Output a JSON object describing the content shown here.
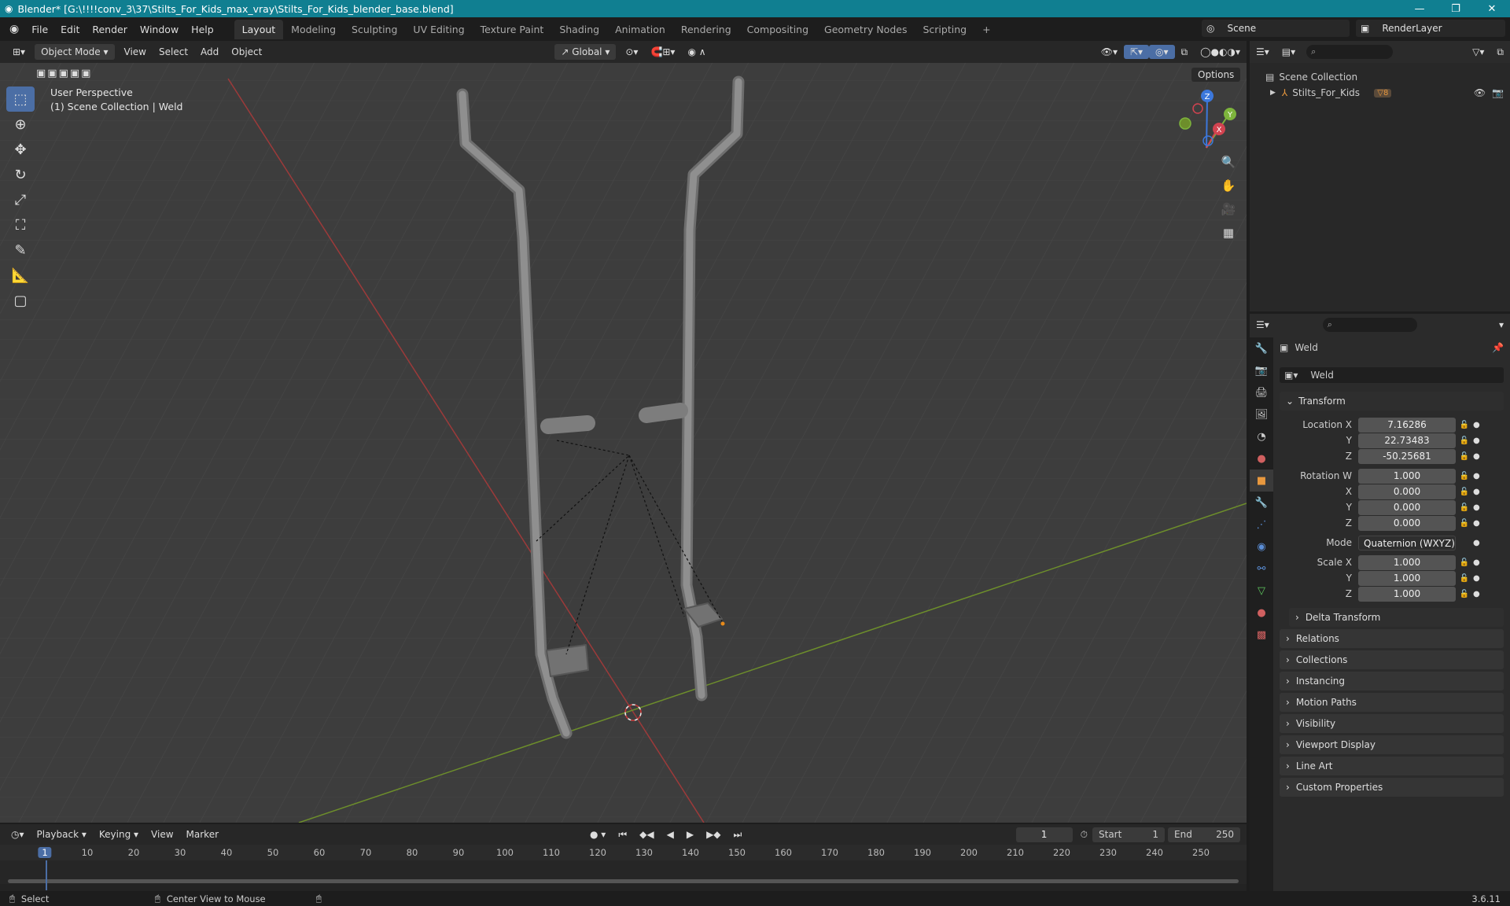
{
  "window": {
    "title": "Blender* [G:\\!!!!conv_3\\37\\Stilts_For_Kids_max_vray\\Stilts_For_Kids_blender_base.blend]"
  },
  "menu": [
    "File",
    "Edit",
    "Render",
    "Window",
    "Help"
  ],
  "workspaces": [
    "Layout",
    "Modeling",
    "Sculpting",
    "UV Editing",
    "Texture Paint",
    "Shading",
    "Animation",
    "Rendering",
    "Compositing",
    "Geometry Nodes",
    "Scripting"
  ],
  "scene": "Scene",
  "render_layer": "RenderLayer",
  "viewport": {
    "mode": "Object Mode",
    "menus": [
      "View",
      "Select",
      "Add",
      "Object"
    ],
    "orientation": "Global",
    "options": "Options",
    "info_line1": "User Perspective",
    "info_line2": "(1) Scene Collection | Weld",
    "gizmo": {
      "x": "X",
      "y": "Y",
      "z": "Z"
    }
  },
  "outliner": {
    "root": "Scene Collection",
    "item": "Stilts_For_Kids",
    "item_badge": "8"
  },
  "properties": {
    "object_name": "Weld",
    "data_name": "Weld",
    "transform_label": "Transform",
    "location_x_label": "Location X",
    "location_x": "7.16286",
    "location_y_label": "Y",
    "location_y": "22.73483",
    "location_z_label": "Z",
    "location_z": "-50.25681",
    "rotation_w_label": "Rotation W",
    "rotation_w": "1.000",
    "rotation_x_label": "X",
    "rotation_x": "0.000",
    "rotation_y_label": "Y",
    "rotation_y": "0.000",
    "rotation_z_label": "Z",
    "rotation_z": "0.000",
    "mode_label": "Mode",
    "mode": "Quaternion (WXYZ)",
    "scale_x_label": "Scale X",
    "scale_x": "1.000",
    "scale_y_label": "Y",
    "scale_y": "1.000",
    "scale_z_label": "Z",
    "scale_z": "1.000",
    "delta_transform": "Delta Transform",
    "panels": [
      "Relations",
      "Collections",
      "Instancing",
      "Motion Paths",
      "Visibility",
      "Viewport Display",
      "Line Art",
      "Custom Properties"
    ]
  },
  "timeline": {
    "menus": [
      "Playback",
      "Keying",
      "View",
      "Marker"
    ],
    "current_frame": "1",
    "start_label": "Start",
    "start": "1",
    "end_label": "End",
    "end": "250",
    "ruler": [
      "1",
      "10",
      "20",
      "30",
      "40",
      "50",
      "60",
      "70",
      "80",
      "90",
      "100",
      "110",
      "120",
      "130",
      "140",
      "150",
      "160",
      "170",
      "180",
      "190",
      "200",
      "210",
      "220",
      "230",
      "240",
      "250"
    ]
  },
  "status": {
    "select": "Select",
    "center_view": "Center View to Mouse",
    "version": "3.6.11"
  },
  "colors": {
    "titlebar": "#107f91",
    "viewport_bg": "#3d3d3d",
    "accent": "#4b6ea5",
    "axis_x": "#d24350",
    "axis_y": "#7db43c",
    "axis_z": "#3c78dc"
  }
}
